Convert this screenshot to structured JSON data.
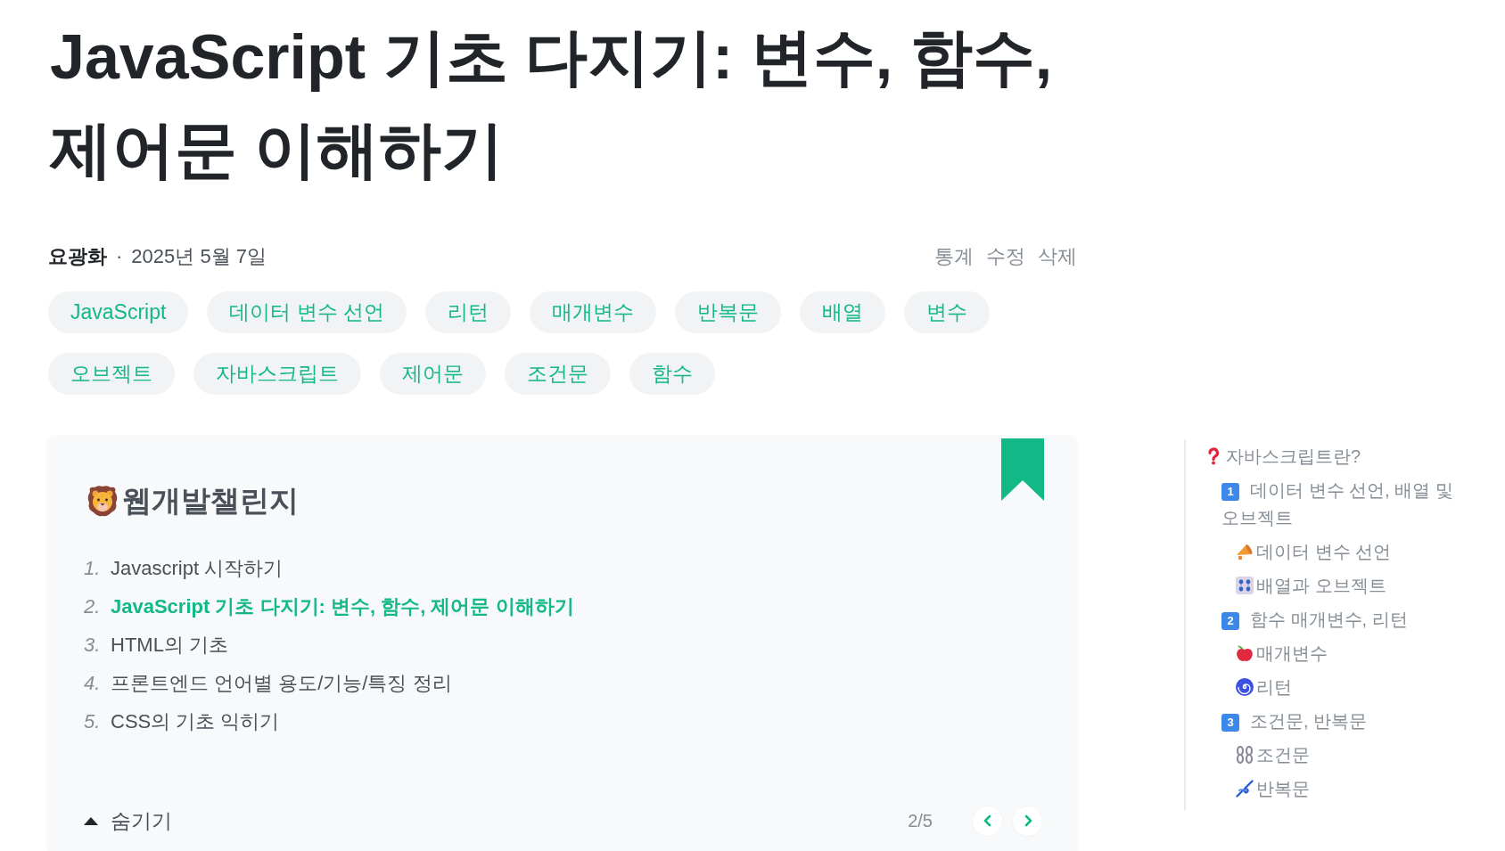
{
  "post": {
    "title": "JavaScript 기초 다지기: 변수, 함수, 제어문 이해하기",
    "author": "요광화",
    "separator": "·",
    "date": "2025년 5월 7일",
    "actions": [
      "통계",
      "수정",
      "삭제"
    ],
    "tags": [
      "JavaScript",
      "데이터 변수 선언",
      "리턴",
      "매개변수",
      "반복문",
      "배열",
      "변수",
      "오브젝트",
      "자바스크립트",
      "제어문",
      "조건문",
      "함수"
    ]
  },
  "series": {
    "name": "웹개발챌린지",
    "items": [
      {
        "number": "1.",
        "title": "Javascript 시작하기",
        "selected": false
      },
      {
        "number": "2.",
        "title": "JavaScript 기초 다지기: 변수, 함수, 제어문 이해하기",
        "selected": true
      },
      {
        "number": "3.",
        "title": "HTML의 기초",
        "selected": false
      },
      {
        "number": "4.",
        "title": "프론트엔드 언어별 용도/기능/특징 정리",
        "selected": false
      },
      {
        "number": "5.",
        "title": "CSS의 기초 익히기",
        "selected": false
      }
    ],
    "toggle": "숨기기",
    "expanded": true,
    "position": "2/5"
  },
  "toc": [
    {
      "text": "자바스크립트란?",
      "children": [
        {
          "keycap": "1",
          "text": "데이터 변수 선언, 배열 및 오브젝트",
          "children": [
            {
              "text": "데이터 변수 선언"
            },
            {
              "text": "배열과 오브젝트"
            }
          ]
        },
        {
          "keycap": "2",
          "text": "함수 매개변수, 리턴",
          "children": [
            {
              "text": "매개변수"
            },
            {
              "text": "리턴"
            }
          ]
        },
        {
          "keycap": "3",
          "text": "조건문, 반복문",
          "children": [
            {
              "text": "조건문"
            },
            {
              "text": "반복문"
            }
          ]
        }
      ]
    }
  ]
}
